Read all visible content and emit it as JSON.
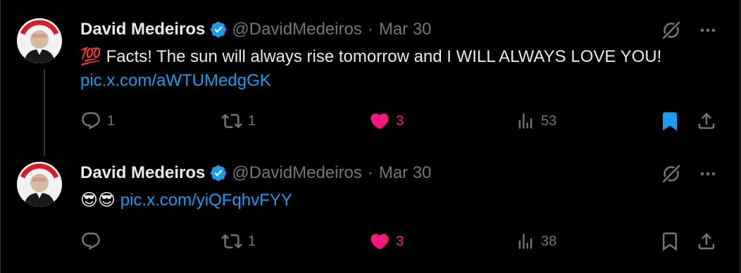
{
  "tweets": [
    {
      "author_name": "David Medeiros",
      "handle": "@DavidMedeiros",
      "separator": "·",
      "date": "Mar 30",
      "text_emoji": "💯",
      "text": "Facts! The sun will always rise tomorrow and I WILL ALWAYS LOVE YOU!",
      "link": "pic.x.com/aWTUMedgGK",
      "reply_count": "1",
      "retweet_count": "1",
      "like_count": "3",
      "views_count": "53",
      "bookmarked": true,
      "liked": true
    },
    {
      "author_name": "David Medeiros",
      "handle": "@DavidMedeiros",
      "separator": "·",
      "date": "Mar 30",
      "text_emoji": "😎😎",
      "link": "pic.x.com/yiQFqhvFYY",
      "retweet_count": "1",
      "like_count": "3",
      "views_count": "38",
      "bookmarked": false,
      "liked": true
    }
  ],
  "icons": {
    "verified": "verified-badge-icon",
    "grok": "grok-icon",
    "more": "more-icon",
    "reply": "reply-icon",
    "retweet": "retweet-icon",
    "like": "heart-icon",
    "views": "views-icon",
    "bookmark": "bookmark-icon",
    "share": "share-icon"
  },
  "colors": {
    "background": "#000000",
    "text": "#e7e9ea",
    "muted": "#71767b",
    "link": "#1d9bf0",
    "like": "#f91880",
    "verified": "#1d9bf0"
  }
}
